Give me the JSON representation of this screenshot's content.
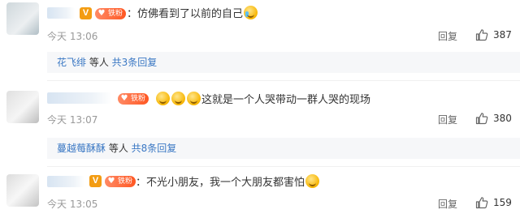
{
  "comments": [
    {
      "text": "：仿佛看到了以前的自己",
      "emoji": "crying-laughing",
      "time": "今天 13:06",
      "reply_label": "回复",
      "likes": "387",
      "badge": "铁粉",
      "verify": "V",
      "subreply": {
        "user": "花飞绯",
        "middle": " 等人 ",
        "count": "共3条回复"
      }
    },
    {
      "text": "这就是一个人哭带动一群人哭的现场",
      "emoji": "laughing",
      "time": "今天 13:07",
      "reply_label": "回复",
      "likes": "380",
      "badge": "铁粉",
      "subreply": {
        "user": "蔓越莓酥酥",
        "middle": " 等人 ",
        "count": "共8条回复"
      }
    },
    {
      "text": "：不光小朋友，我一个大朋友都害怕",
      "emoji": "fearful",
      "time": "今天 13:05",
      "reply_label": "回复",
      "likes": "159",
      "badge": "铁粉",
      "verify": "V"
    }
  ],
  "colors": {
    "link": "#3b78c4",
    "badge": "#ff5722",
    "verify": "#f39c12"
  },
  "icons": {
    "like": "thumbs-up-icon"
  }
}
